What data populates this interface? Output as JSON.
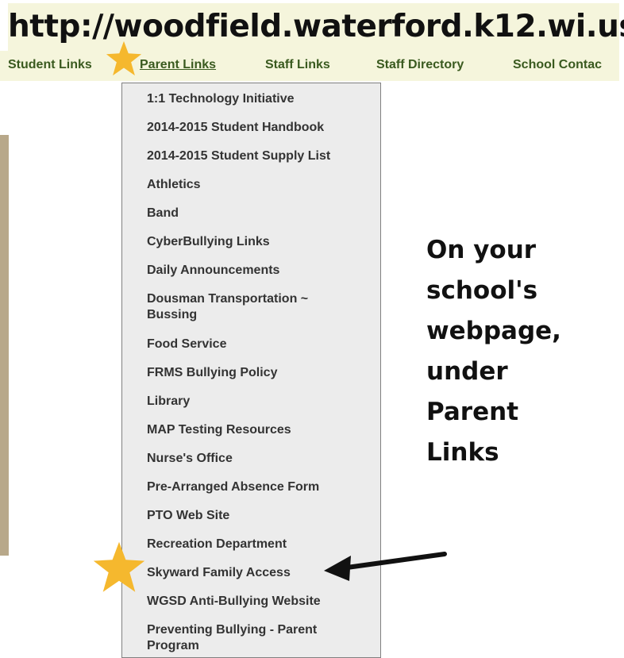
{
  "header": {
    "url": "http://woodfield.waterford.k12.wi.us"
  },
  "nav": {
    "items": [
      {
        "label": "Student Links"
      },
      {
        "label": "Parent Links"
      },
      {
        "label": "Staff Links"
      },
      {
        "label": "Staff Directory"
      },
      {
        "label": "School Contac"
      }
    ]
  },
  "menu": {
    "items": [
      {
        "label": "1:1 Technology Initiative"
      },
      {
        "label": "2014-2015 Student Handbook"
      },
      {
        "label": "2014-2015 Student Supply List"
      },
      {
        "label": "Athletics"
      },
      {
        "label": "Band"
      },
      {
        "label": "CyberBullying Links"
      },
      {
        "label": "Daily Announcements"
      },
      {
        "label": "Dousman Transportation ~ Bussing"
      },
      {
        "label": "Food Service"
      },
      {
        "label": "FRMS Bullying Policy"
      },
      {
        "label": "Library"
      },
      {
        "label": "MAP Testing Resources"
      },
      {
        "label": "Nurse's Office"
      },
      {
        "label": "Pre-Arranged Absence Form"
      },
      {
        "label": "PTO Web Site"
      },
      {
        "label": "Recreation Department"
      },
      {
        "label": "Skyward Family Access"
      },
      {
        "label": "WGSD Anti-Bullying Website"
      },
      {
        "label": "Preventing Bullying - Parent Program"
      }
    ]
  },
  "annotation": {
    "text": "On your\nschool's\nwebpage,\nunder\nParent\nLinks"
  },
  "colors": {
    "nav_background": "#f5f5dc",
    "nav_text": "#3a5a1f",
    "menu_background": "#ececec",
    "star": "#f5b82e"
  }
}
